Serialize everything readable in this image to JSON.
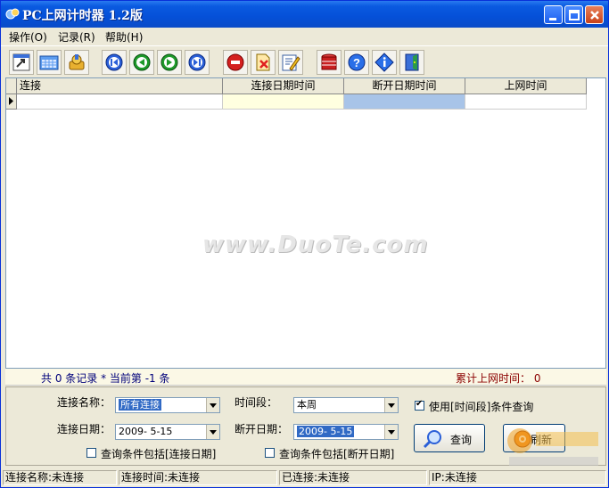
{
  "window": {
    "title": "PC上网计时器 1.2版"
  },
  "menu": [
    {
      "label": "操作(O)"
    },
    {
      "label": "记录(R)"
    },
    {
      "label": "帮助(H)"
    }
  ],
  "toolbar": {
    "icons": [
      "shortcut-icon",
      "calendar-icon",
      "connect-icon",
      "first-record-icon",
      "previous-record-icon",
      "next-record-icon",
      "last-record-icon",
      "stop-icon",
      "delete-icon",
      "edit-icon",
      "archive-icon",
      "help-icon",
      "info-icon",
      "exit-icon"
    ]
  },
  "grid": {
    "columns": [
      "连接",
      "连接日期时间",
      "断开日期时间",
      "上网时间"
    ],
    "rows": [
      [
        "",
        "",
        "",
        ""
      ]
    ]
  },
  "watermark": "www.DuoTe.com",
  "info": {
    "records": "共 0 条记录 * 当前第 -1 条",
    "total": "累计上网时间： 0"
  },
  "query": {
    "conn_name_label": "连接名称：",
    "conn_name_value": "所有连接",
    "period_label": "时间段：",
    "period_value": "本周",
    "use_period_label": "使用[时间段]条件查询",
    "use_period_checked": true,
    "conn_date_label": "连接日期：",
    "conn_date_value": "2009- 5-15",
    "disc_date_label": "断开日期：",
    "disc_date_value": "2009- 5-15",
    "include_conn_label": "查询条件包括[连接日期]",
    "include_disc_label": "查询条件包括[断开日期]",
    "query_button": "查询",
    "refresh_button": "刷新"
  },
  "status": {
    "conn_name": "连接名称:未连接",
    "conn_time": "连接时间:未连接",
    "connected": "已连接:未连接",
    "ip": "IP:未连接"
  },
  "colors": {
    "titlebar": "#0a5ae0",
    "selection": "#316ac5"
  }
}
